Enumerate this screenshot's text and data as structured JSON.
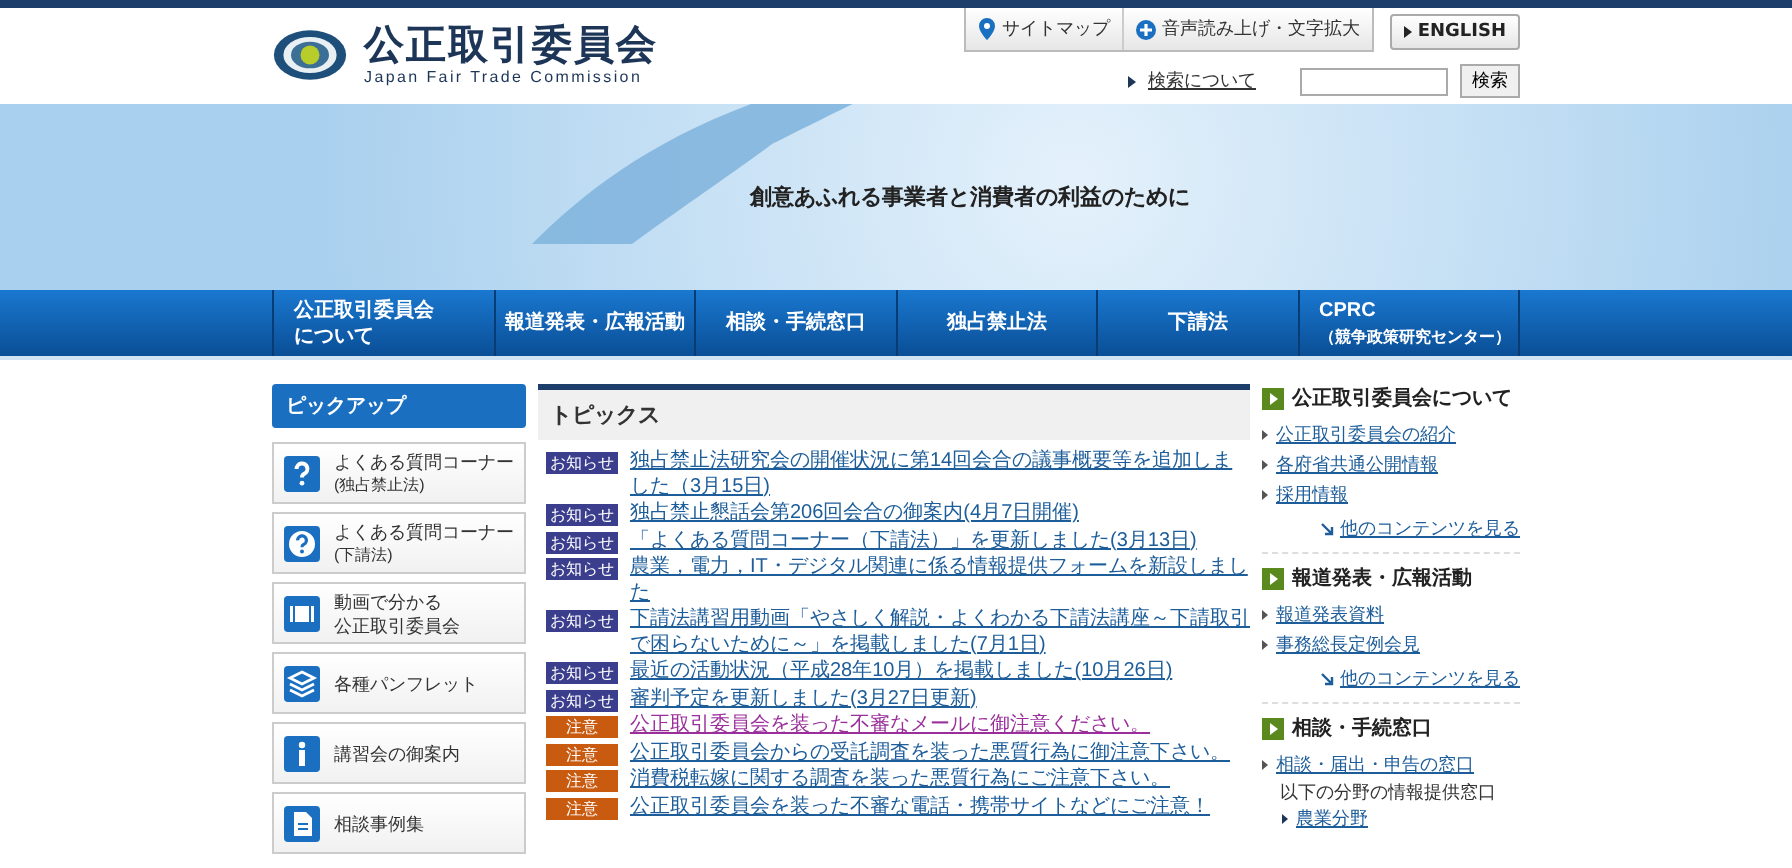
{
  "header": {
    "title": "公正取引委員会",
    "subtitle": "Japan Fair Trade Commission",
    "utility": [
      {
        "kind": "pin",
        "label": "サイトマップ"
      },
      {
        "kind": "plus",
        "label": "音声読み上げ・文字拡大"
      }
    ],
    "language": "ENGLISH",
    "search_link": "検索について",
    "search_button": "検索"
  },
  "banner": {
    "tagline": "創意あふれる事業者と消費者の利益のために"
  },
  "nav": [
    {
      "lines": [
        "公正取引委員会",
        "について"
      ]
    },
    {
      "lines": [
        "報道発表・広報活動"
      ]
    },
    {
      "lines": [
        "相談・手続窓口"
      ]
    },
    {
      "lines": [
        "独占禁止法"
      ]
    },
    {
      "lines": [
        "下請法"
      ]
    },
    {
      "lines": [
        "CPRC",
        "（競争政策研究センター）"
      ]
    }
  ],
  "pickup": {
    "title": "ピックアップ",
    "items": [
      {
        "kind": "question",
        "lines": [
          "よくある質問コーナー"
        ],
        "note": "(独占禁止法)"
      },
      {
        "kind": "question-circle",
        "lines": [
          "よくある質問コーナー"
        ],
        "note": "(下請法)"
      },
      {
        "kind": "film",
        "lines": [
          "動画で分かる",
          "公正取引委員会"
        ]
      },
      {
        "kind": "layers",
        "lines": [
          "各種パンフレット"
        ]
      },
      {
        "kind": "info",
        "lines": [
          "講習会の御案内"
        ]
      },
      {
        "kind": "document",
        "lines": [
          "相談事例集"
        ]
      }
    ]
  },
  "topics": {
    "title": "トピックス",
    "items": [
      {
        "kind": "notice",
        "tag": "お知らせ",
        "text": "独占禁止法研究会の開催状況に第14回会合の議事概要等を追加しました（3月15日)",
        "visited": false
      },
      {
        "kind": "notice",
        "tag": "お知らせ",
        "text": "独占禁止懇話会第206回会合の御案内(4月7日開催)",
        "visited": false
      },
      {
        "kind": "notice",
        "tag": "お知らせ",
        "text": "「よくある質問コーナー（下請法）」を更新しました(3月13日)",
        "visited": false
      },
      {
        "kind": "notice",
        "tag": "お知らせ",
        "text": "農業，電力，IT・デジタル関連に係る情報提供フォームを新設しました",
        "visited": false
      },
      {
        "kind": "notice",
        "tag": "お知らせ",
        "text": "下請法講習用動画「やさしく解説・よくわかる下請法講座～下請取引で困らないために～」を掲載しました(7月1日)",
        "visited": false
      },
      {
        "kind": "notice",
        "tag": "お知らせ",
        "text": "最近の活動状況（平成28年10月）を掲載しました(10月26日)",
        "visited": false
      },
      {
        "kind": "notice",
        "tag": "お知らせ",
        "text": "審判予定を更新しました(3月27日更新)",
        "visited": false
      },
      {
        "kind": "caution",
        "tag": "注意",
        "text": "公正取引委員会を装った不審なメールに御注意ください。",
        "visited": true
      },
      {
        "kind": "caution",
        "tag": "注意",
        "text": "公正取引委員会からの受託調査を装った悪質行為に御注意下さい。",
        "visited": false
      },
      {
        "kind": "caution",
        "tag": "注意",
        "text": "消費税転嫁に関する調査を装った悪質行為にご注意下さい。",
        "visited": false
      },
      {
        "kind": "caution",
        "tag": "注意",
        "text": "公正取引委員会を装った不審な電話・携帯サイトなどにご注意！",
        "visited": false
      }
    ]
  },
  "side_sections": [
    {
      "title": "公正取引委員会について",
      "links": [
        {
          "label": "公正取引委員会の紹介"
        },
        {
          "label": "各府省共通公開情報"
        },
        {
          "label": "採用情報"
        }
      ],
      "more": "他のコンテンツを見る"
    },
    {
      "title": "報道発表・広報活動",
      "links": [
        {
          "label": "報道発表資料"
        },
        {
          "label": "事務総長定例会見"
        }
      ],
      "more": "他のコンテンツを見る"
    },
    {
      "title": "相談・手続窓口",
      "links": [
        {
          "label": "相談・届出・申告の窓口",
          "note": "以下の分野の情報提供窓口",
          "children": [
            {
              "label": "農業分野"
            }
          ]
        }
      ]
    }
  ]
}
